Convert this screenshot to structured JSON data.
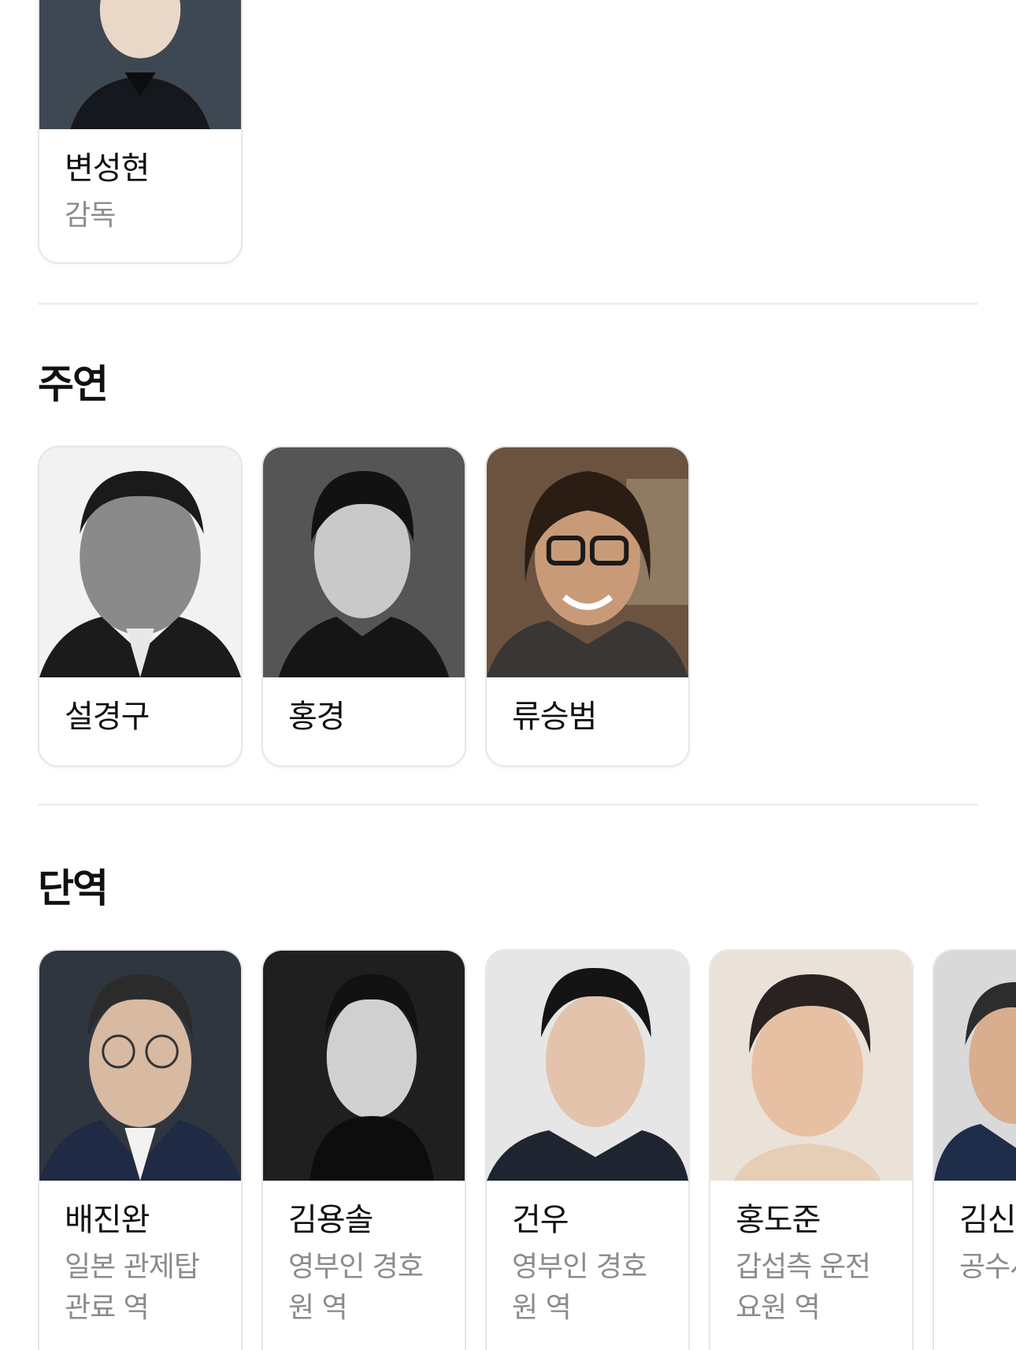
{
  "director": {
    "name": "변성현",
    "role": "감독"
  },
  "lead": {
    "title": "주연",
    "cast": [
      {
        "name": "설경구"
      },
      {
        "name": "홍경"
      },
      {
        "name": "류승범"
      }
    ]
  },
  "cameo": {
    "title": "단역",
    "cast": [
      {
        "name": "배진완",
        "role": "일본 관제탑 관료 역"
      },
      {
        "name": "김용솔",
        "role": "영부인 경호원 역"
      },
      {
        "name": "건우",
        "role": "영부인 경호원 역"
      },
      {
        "name": "홍도준",
        "role": "갑섭측 운전요원 역"
      },
      {
        "name": "김신",
        "role": "공수사 역"
      }
    ]
  }
}
